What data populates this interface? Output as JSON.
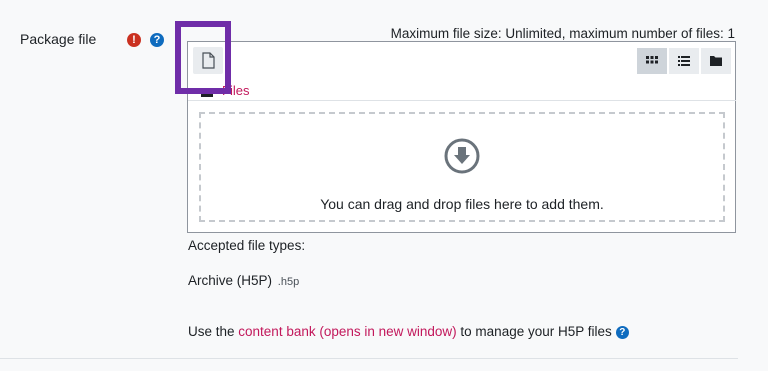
{
  "field": {
    "label": "Package file",
    "required_icon": "exclamation-icon",
    "help_icon": "question-icon"
  },
  "filepicker": {
    "max_info": "Maximum file size: Unlimited, maximum number of files: 1",
    "add_button_icon": "file-icon",
    "views": [
      "grid-view-icon",
      "list-view-icon",
      "folder-view-icon"
    ],
    "breadcrumb": "Files",
    "drop_text": "You can drag and drop files here to add them.",
    "drop_icon": "arrow-down-circle-icon"
  },
  "accepted": {
    "heading": "Accepted file types:",
    "type_name": "Archive (H5P)",
    "type_ext": ".h5p"
  },
  "footer": {
    "prefix": "Use the ",
    "link": "content bank (opens in new window)",
    "suffix": " to manage your H5P files"
  },
  "colors": {
    "link": "#c2185b",
    "required": "#ca3120",
    "help": "#0f6cbf",
    "highlight": "#6f2da8"
  }
}
